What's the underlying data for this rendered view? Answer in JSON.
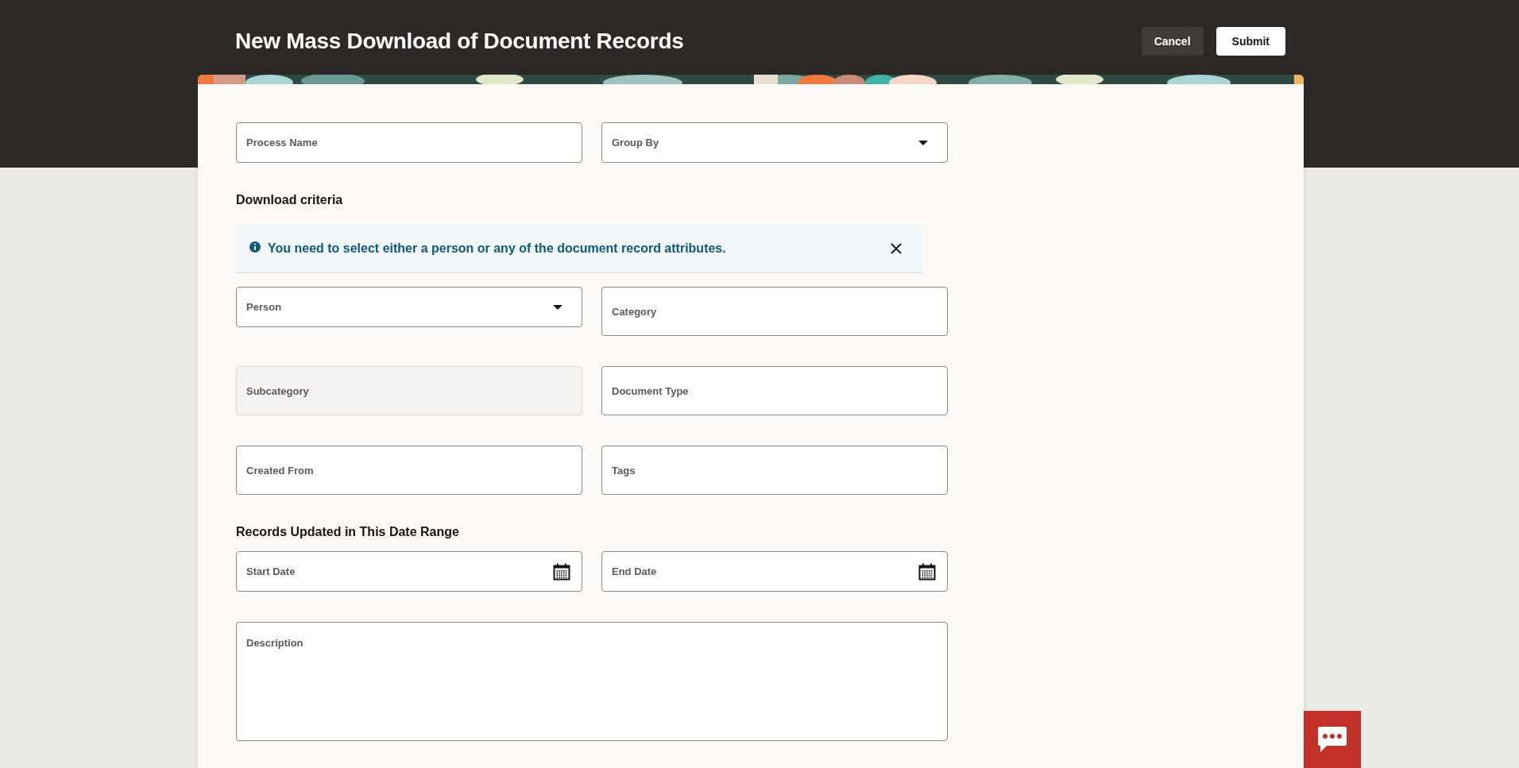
{
  "header": {
    "title": "New Mass Download of Document Records",
    "buttons": [
      {
        "label": "Cancel",
        "kind": "secondary"
      },
      {
        "label": "Submit",
        "kind": "primary"
      }
    ]
  },
  "form": [
    {
      "kind": "fields",
      "fields": [
        {
          "label": "Process Name",
          "kind": "text",
          "disabled": false
        },
        {
          "label": "Group By",
          "kind": "dropdown",
          "disabled": false
        }
      ]
    },
    {
      "kind": "heading",
      "text": "Download criteria"
    },
    {
      "kind": "message",
      "text": "You need to select either a person or any of the document record attributes.",
      "closable": true
    },
    {
      "kind": "fields",
      "fields": [
        {
          "label": "Person",
          "kind": "dropdown",
          "disabled": false
        },
        {
          "label": "Category",
          "kind": "text",
          "disabled": false
        }
      ]
    },
    {
      "kind": "fields",
      "fields": [
        {
          "label": "Subcategory",
          "kind": "text",
          "disabled": true
        },
        {
          "label": "Document Type",
          "kind": "text",
          "disabled": false
        }
      ]
    },
    {
      "kind": "fields",
      "fields": [
        {
          "label": "Created From",
          "kind": "text",
          "disabled": false
        },
        {
          "label": "Tags",
          "kind": "text",
          "disabled": false
        }
      ]
    },
    {
      "kind": "heading",
      "text": "Records Updated in This Date Range"
    },
    {
      "kind": "fields",
      "fields": [
        {
          "label": "Start Date",
          "kind": "date",
          "disabled": false
        },
        {
          "label": "End Date",
          "kind": "date",
          "disabled": false
        }
      ]
    },
    {
      "kind": "fields",
      "fields": [
        {
          "label": "Description",
          "kind": "textarea",
          "disabled": false
        }
      ]
    }
  ]
}
